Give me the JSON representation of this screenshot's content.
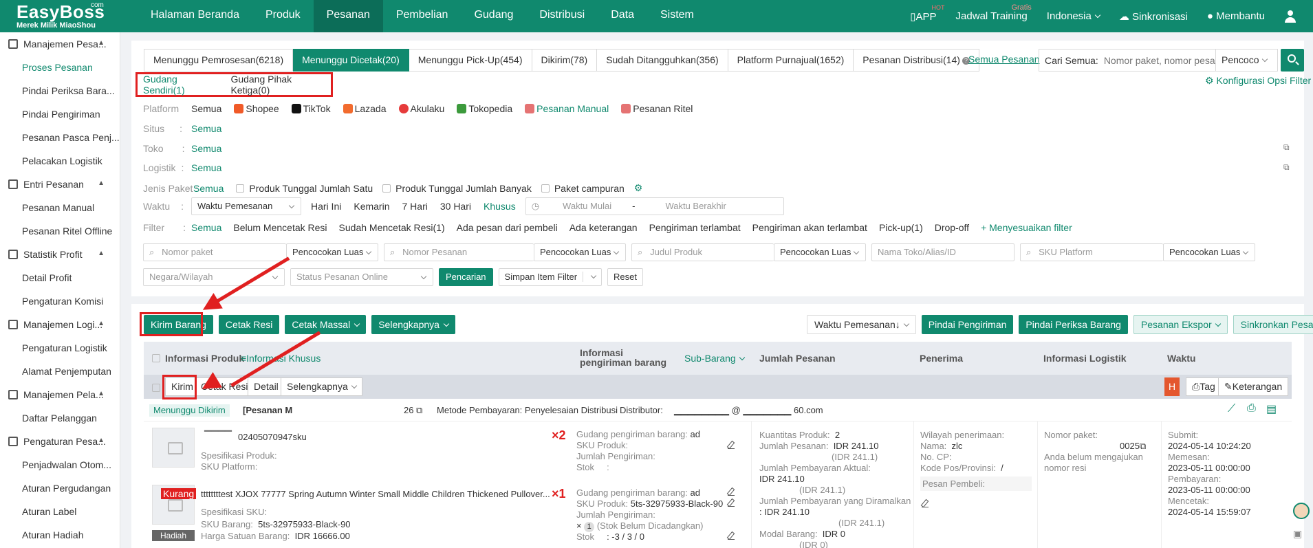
{
  "app": {
    "logo": "EasyBoss",
    "logo_com": "com",
    "logo_sub": "Merek Milik MiaoShou"
  },
  "nav": [
    "Halaman Beranda",
    "Produk",
    "Pesanan",
    "Pembelian",
    "Gudang",
    "Distribusi",
    "Data",
    "Sistem"
  ],
  "topright": {
    "app": "APP",
    "app_hot": "HOT",
    "training": "Jadwal Training",
    "training_badge": "Gratis",
    "language": "Indonesia",
    "sync": "Sinkronisasi",
    "help": "Membantu"
  },
  "sidebar": {
    "groups": [
      {
        "label": "Manajemen Pesa...",
        "items": [
          "Proses Pesanan",
          "Pindai Periksa Bara...",
          "Pindai Pengiriman",
          "Pesanan Pasca Penj...",
          "Pelacakan Logistik"
        ]
      },
      {
        "label": "Entri Pesanan",
        "items": [
          "Pesanan Manual",
          "Pesanan Ritel Offline"
        ]
      },
      {
        "label": "Statistik Profit",
        "items": [
          "Detail Profit",
          "Pengaturan Komisi"
        ]
      },
      {
        "label": "Manajemen Logi...",
        "items": [
          "Pengaturan Logistik",
          "Alamat Penjemputan"
        ]
      },
      {
        "label": "Manajemen Pela...",
        "items": [
          "Daftar Pelanggan"
        ]
      },
      {
        "label": "Pengaturan Pesa...",
        "items": [
          "Penjadwalan Otom...",
          "Aturan Pergudangan",
          "Aturan Label",
          "Aturan Hadiah"
        ]
      }
    ]
  },
  "tabs": [
    "Menunggu Pemrosesan(6218)",
    "Menunggu Dicetak(20)",
    "Menunggu Pick-Up(454)",
    "Dikirim(78)",
    "Sudah Ditangguhkan(356)",
    "Platform Purnajual(1652)",
    "Pesanan Distribusi(14)"
  ],
  "all_orders": "Semua Pesanan",
  "search": {
    "label": "Cari Semua:",
    "placeholder": "Nomor paket, nomor pesar",
    "mode": "Pencoco"
  },
  "warehouse": {
    "own": "Gudang Sendiri(1)",
    "third": "Gudang Pihak Ketiga(0)"
  },
  "config": "Konfigurasi Opsi Filter",
  "filters": {
    "platform_label": "Platform",
    "platforms": [
      "Semua",
      "Shopee",
      "TikTok",
      "Lazada",
      "Akulaku",
      "Tokopedia",
      "Pesanan Manual",
      "Pesanan Ritel"
    ],
    "situs_label": "Situs",
    "toko_label": "Toko",
    "logistik_label": "Logistik",
    "all": "Semua",
    "jenis_label": "Jenis Paket",
    "jenis": [
      "Produk Tunggal Jumlah Satu",
      "Produk Tunggal Jumlah Banyak",
      "Paket campuran"
    ],
    "waktu_label": "Waktu",
    "waktu_sel": "Waktu Pemesanan",
    "waktu_opts": [
      "Hari Ini",
      "Kemarin",
      "7 Hari",
      "30 Hari",
      "Khusus"
    ],
    "start": "Waktu Mulai",
    "dash": "-",
    "end": "Waktu Berakhir",
    "filter_label": "Filter",
    "filter_opts": [
      "Semua",
      "Belum Mencetak Resi",
      "Sudah Mencetak Resi(1)",
      "Ada pesan dari pembeli",
      "Ada keterangan",
      "Pengiriman terlambat",
      "Pengiriman akan terlambat",
      "Pick-up(1)",
      "Drop-off"
    ],
    "custom": "+ Menyesuaikan filter",
    "inputs": [
      "Nomor paket",
      "Nomor Pesanan",
      "Judul Produk",
      "Nama Toko/Alias/ID",
      "SKU Platform"
    ],
    "match": "Pencocokan Luas",
    "country": "Negara/Wilayah",
    "status_online": "Status Pesanan Online",
    "search_btn": "Pencarian",
    "save_filter": "Simpan Item Filter",
    "reset": "Reset"
  },
  "actions": {
    "kirim": "Kirim Barang",
    "cetak": "Cetak Resi",
    "massal": "Cetak Massal",
    "lainnya": "Selengkapnya",
    "sort": "Waktu Pemesanan↓",
    "pindai_kirim": "Pindai Pengiriman",
    "pindai_periksa": "Pindai Periksa Barang",
    "ekspor": "Pesanan Ekspor",
    "sinkron": "Sinkronkan Pesanan"
  },
  "table": {
    "h_produk": "Informasi Produk",
    "h_khusus": "Informasi Khusus",
    "h_kirim": "Informasi pengiriman barang",
    "h_sub": "Sub-Barang",
    "h_jumlah": "Jumlah Pesanan",
    "h_penerima": "Penerima",
    "h_logistik": "Informasi Logistik",
    "h_waktu": "Waktu"
  },
  "row_actions": {
    "kirim": "Kirim",
    "cetak": "Cetak Resi",
    "detail": "Detail",
    "lainnya": "Selengkapnya",
    "h": "H",
    "tag": "Tag",
    "ket": "Keterangan"
  },
  "order": {
    "status": "Menunggu Dikirim",
    "type": "[Pesanan M",
    "no_tail": "26",
    "payment": "Metode Pembayaran: Penyelesaian Distribusi",
    "distributor": "Distributor:",
    "email_tail": "60.com",
    "item1": {
      "sku": "02405070947sku",
      "spec": "Spesifikasi Produk:",
      "sku_platform": "SKU Platform:",
      "qty": "×2",
      "gudang": "Gudang pengiriman barang:",
      "gudang_val": "ad",
      "sku_produk": "SKU Produk:",
      "jumlah_kirim": "Jumlah Pengiriman:",
      "stok": "Stok",
      "stok_sep": ":"
    },
    "item2": {
      "badge": "Kurang",
      "gift": "Hadiah",
      "title": "ttttttttest XJOX 77777 Spring Autumn Winter Small Middle Children Thickened Pullover...",
      "spec": "Spesifikasi SKU:",
      "sku_label": "SKU Barang:",
      "sku_val": "5ts-32975933-Black-90",
      "price_label": "Harga Satuan Barang:",
      "price_val": "IDR 16666.00",
      "qty": "×1",
      "gudang": "Gudang pengiriman barang:",
      "gudang_val": "ad",
      "sku_produk": "SKU Produk:",
      "sku_produk_val": "5ts-32975933-Black-90",
      "jumlah_kirim": "Jumlah Pengiriman:",
      "jumlah_val": "×",
      "jumlah_num": "1",
      "jumlah_note": "(Stok Belum Dicadangkan)",
      "stok": "Stok",
      "stok_val": ":   -3 / 3 / 0"
    },
    "amounts": {
      "qty_label": "Kuantitas Produk:",
      "qty_val": "2",
      "total_label": "Jumlah Pesanan:",
      "total_val": "IDR 241.10",
      "total_sub": "(IDR 241.1)",
      "actual_label": "Jumlah Pembayaran Aktual:",
      "actual_val": "IDR 241.10",
      "actual_sub": "(IDR 241.1)",
      "forecast_label": "Jumlah Pembayaran yang Diramalkan",
      "forecast_val": ": IDR 241.10",
      "forecast_sub": "(IDR 241.1)",
      "modal_label": "Modal Barang:",
      "modal_val": "IDR 0",
      "modal_sub": "(IDR 0)"
    },
    "receiver": {
      "region": "Wilayah penerimaan:",
      "name_label": "Nama:",
      "name_val": "zlc",
      "cp": "No. CP:",
      "postal": "Kode Pos/Provinsi:",
      "postal_val": "/",
      "msg": "Pesan Pembeli:"
    },
    "logistic": {
      "pkg": "Nomor paket:",
      "pkg_val": "0025",
      "note": "Anda belum mengajukan",
      "note2": "nomor resi"
    },
    "times": {
      "submit": "Submit:",
      "submit_val": "2024-05-14 10:24:20",
      "order": "Memesan:",
      "order_val": "2023-05-11 00:00:00",
      "pay": "Pembayaran:",
      "pay_val": "2023-05-11 00:00:00",
      "print": "Mencetak:",
      "print_val": "2024-05-14 15:59:07"
    }
  },
  "colors": {
    "brand": "#10896e",
    "highlight": "#e02020"
  }
}
